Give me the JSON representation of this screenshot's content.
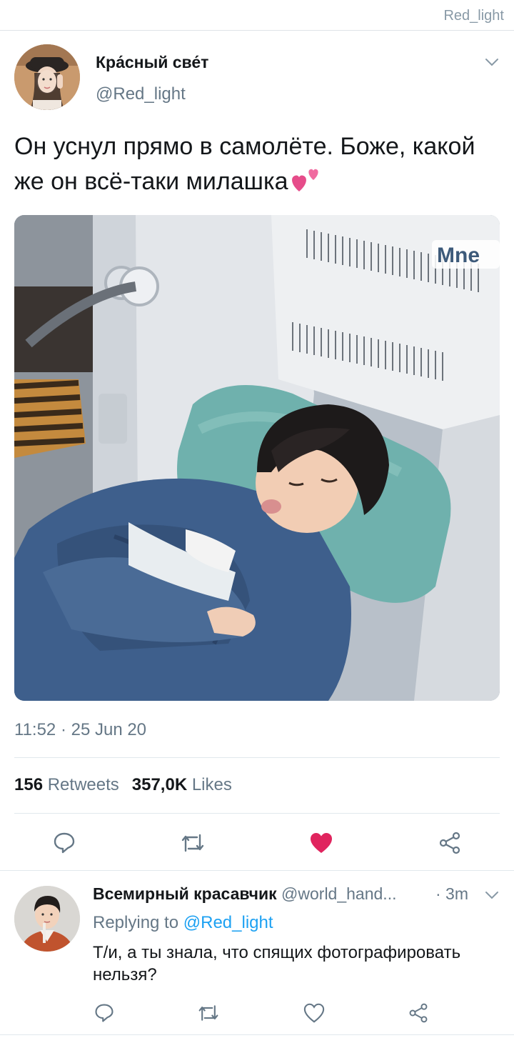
{
  "header": {
    "handle": "Red_light"
  },
  "tweet": {
    "author_name": "Кра́сный све́т",
    "author_handle": "@Red_light",
    "text": "Он уснул прямо в самолёте. Боже, какой же он всё-таки милашка",
    "emoji_icon": "two-hearts-icon",
    "media_watermark": "Mne",
    "timestamp": "11:52 · 25 Jun 20",
    "retweets_count": "156",
    "retweets_label": "Retweets",
    "likes_count": "357,0K",
    "likes_label": "Likes",
    "liked": true
  },
  "reply": {
    "author_name": "Всемирный красавчик",
    "author_handle": "@world_hand...",
    "time": "· 3m",
    "replying_prefix": "Replying to",
    "replying_to": "@Red_light",
    "text": "Т/и, а ты знала, что спящих фотографировать нельзя?"
  },
  "colors": {
    "text": "#14171a",
    "secondary": "#657786",
    "accent": "#1da1f2",
    "like": "#e0245e",
    "divider": "#e1e8ed"
  },
  "icons": [
    "chevron-down-icon",
    "reply-icon",
    "retweet-icon",
    "heart-icon",
    "share-icon"
  ]
}
